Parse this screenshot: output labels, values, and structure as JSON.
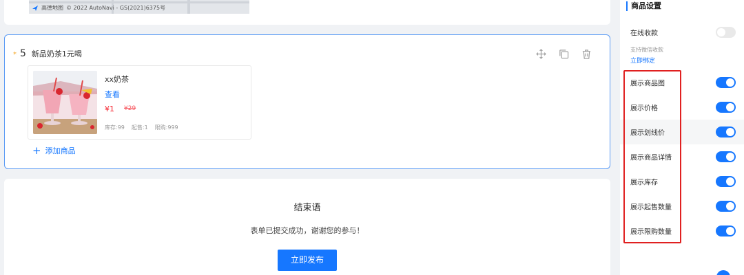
{
  "map": {
    "provider": "高德地图",
    "copyright": "© 2022 AutoNavi - GS(2021)6375号"
  },
  "goods_field": {
    "required_mark": "*",
    "number": "5",
    "title": "新品奶茶1元喝",
    "tools": [
      "move-icon",
      "copy-icon",
      "delete-icon"
    ],
    "product": {
      "name": "xx奶茶",
      "view_link": "查看",
      "price": "¥1",
      "original_price": "¥29",
      "stock": "库存:99",
      "min_purchase": "起售:1",
      "limit": "限购:999"
    },
    "add_label": "添加商品"
  },
  "ending": {
    "title": "结束语",
    "message": "表单已提交成功，谢谢您的参与！",
    "publish_label": "立即发布"
  },
  "panel": {
    "title": "商品设置",
    "online_payment": {
      "label": "在线收款",
      "enabled": false,
      "note": "支持微信收款",
      "bind_link": "立即绑定"
    },
    "toggles": [
      {
        "label": "展示商品图",
        "enabled": true
      },
      {
        "label": "展示价格",
        "enabled": true
      },
      {
        "label": "展示划线价",
        "enabled": true
      },
      {
        "label": "展示商品详情",
        "enabled": true
      },
      {
        "label": "展示库存",
        "enabled": true
      },
      {
        "label": "展示起售数量",
        "enabled": true
      },
      {
        "label": "展示限购数量",
        "enabled": true
      }
    ]
  },
  "colors": {
    "accent": "#1677ff",
    "highlight_box": "#e02020",
    "price": "#f5222d",
    "required": "#f5a623"
  }
}
